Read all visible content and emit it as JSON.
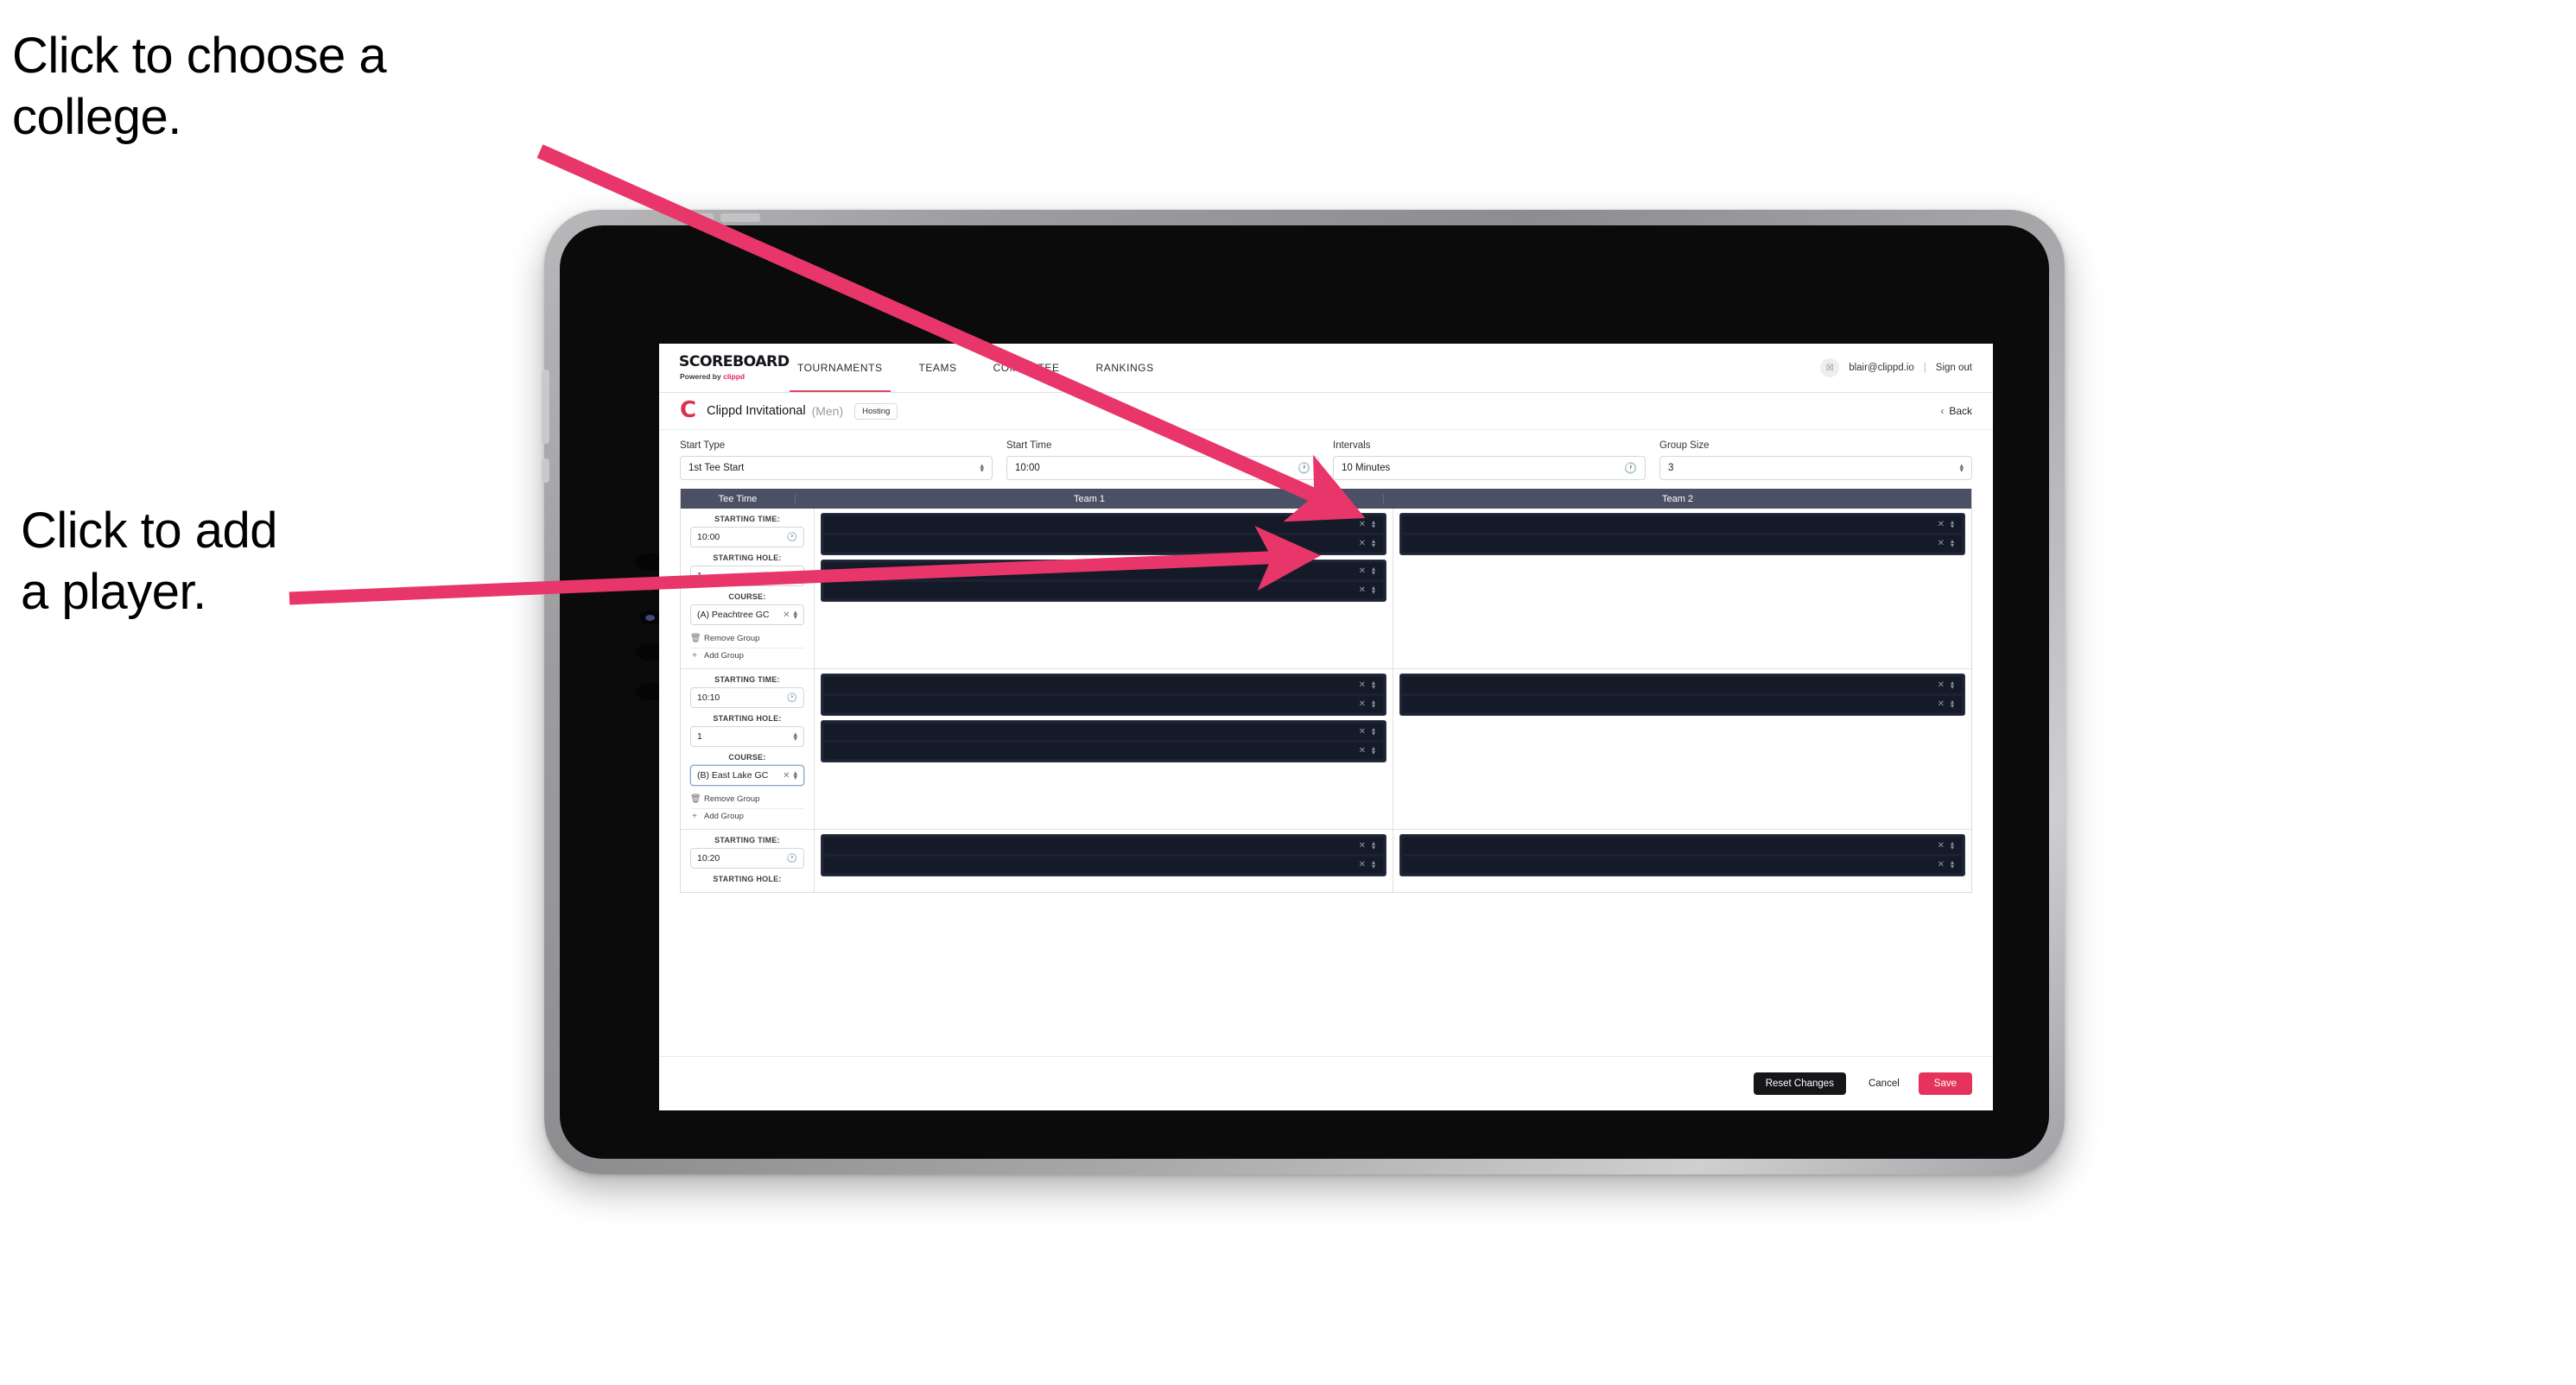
{
  "annotations": [
    {
      "id": "college",
      "text": "Click to choose a\ncollege."
    },
    {
      "id": "player",
      "text": "Click to add\na player."
    }
  ],
  "colors": {
    "accent_pink": "#e6335c",
    "brand_red": "#d8344f",
    "table_header": "#4b5064",
    "player_row_dark": "#141a27",
    "player_box_dark": "#1c2231",
    "annotation_arrow": "#e8366a"
  },
  "topnav": {
    "brand_title": "SCOREBOARD",
    "brand_sub_prefix": "Powered by",
    "brand_sub_name": "clippd",
    "items": [
      {
        "label": "TOURNAMENTS",
        "active": true
      },
      {
        "label": "TEAMS",
        "active": false
      },
      {
        "label": "COMMITTEE",
        "active": false
      },
      {
        "label": "RANKINGS",
        "active": false
      }
    ],
    "avatar_glyph": "☒",
    "user_email": "blair@clippd.io",
    "separator": "|",
    "sign_out": "Sign out"
  },
  "titlerow": {
    "logo_letter": "C",
    "tournament_name": "Clippd Invitational",
    "gender": "(Men)",
    "badge": "Hosting",
    "back_chevron": "‹",
    "back_label": "Back"
  },
  "controls": [
    {
      "label": "Start Type",
      "value": "1st Tee Start",
      "icon": "spinner-icon"
    },
    {
      "label": "Start Time",
      "value": "10:00",
      "icon": "clock-icon"
    },
    {
      "label": "Intervals",
      "value": "10 Minutes",
      "icon": "clock-icon"
    },
    {
      "label": "Group Size",
      "value": "3",
      "icon": "spinner-icon"
    }
  ],
  "table": {
    "headers": [
      "Tee Time",
      "Team 1",
      "Team 2"
    ],
    "field_labels": {
      "starting_time": "STARTING TIME:",
      "starting_hole": "STARTING HOLE:",
      "course": "COURSE:"
    },
    "group_actions": {
      "remove": "Remove Group",
      "remove_icon": "trash-icon",
      "add": "Add Group",
      "add_icon": "plus-icon"
    },
    "rows": [
      {
        "starting_time": "10:00",
        "starting_hole": "1",
        "course": "(A) Peachtree GC",
        "course_focused": false,
        "team1_boxes": [
          2,
          2
        ],
        "team2_boxes": [
          2
        ]
      },
      {
        "starting_time": "10:10",
        "starting_hole": "1",
        "course": "(B) East Lake GC",
        "course_focused": true,
        "team1_boxes": [
          2,
          2
        ],
        "team2_boxes": [
          2
        ]
      },
      {
        "starting_time": "10:20",
        "starting_hole": "",
        "course": "",
        "course_focused": false,
        "team1_boxes": [
          2
        ],
        "team2_boxes": [
          2
        ]
      }
    ],
    "player_row_icons": {
      "remove": "×",
      "reorder": "spinner-icon"
    }
  },
  "footer": {
    "reset": "Reset Changes",
    "cancel": "Cancel",
    "save": "Save"
  }
}
